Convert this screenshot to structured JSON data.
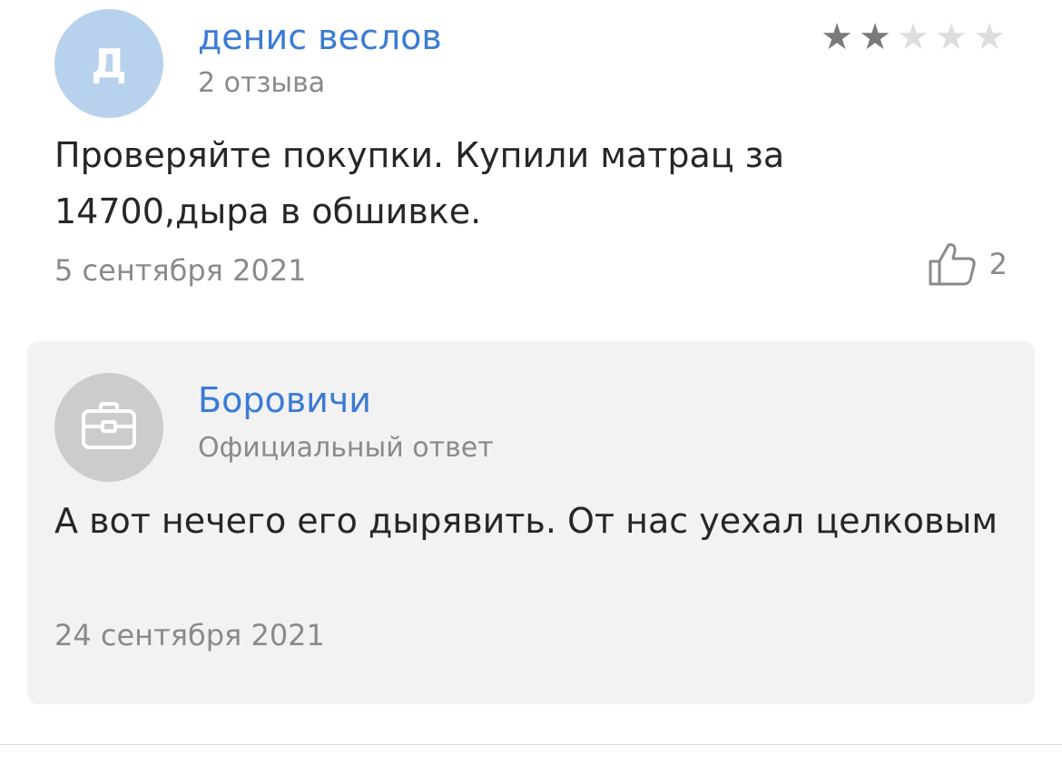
{
  "review": {
    "author": {
      "initial": "Д",
      "name": "денис веслов",
      "reviews_count": "2 отзыва"
    },
    "rating": {
      "value": 2,
      "max": 5,
      "filled_color": "#7a7a7a",
      "empty_color": "#dedede"
    },
    "text": "Проверяйте покупки. Купили матрац за 14700,дыра в обшивке.",
    "date": "5 сентября 2021",
    "likes": {
      "icon": "thumbs-up-icon",
      "count": "2"
    }
  },
  "official_reply": {
    "organization": {
      "icon": "briefcase-icon",
      "name": "Боровичи",
      "label": "Официальный ответ"
    },
    "text": "А вот нечего его дырявить. От нас уехал целковым",
    "date": "24 сентября 2021"
  },
  "colors": {
    "link_blue": "#3a7bd5",
    "muted_gray": "#8a8a8a",
    "user_avatar_bg": "#b8d1ec",
    "org_avatar_bg": "#cccccc",
    "reply_bg": "#f2f2f2"
  }
}
